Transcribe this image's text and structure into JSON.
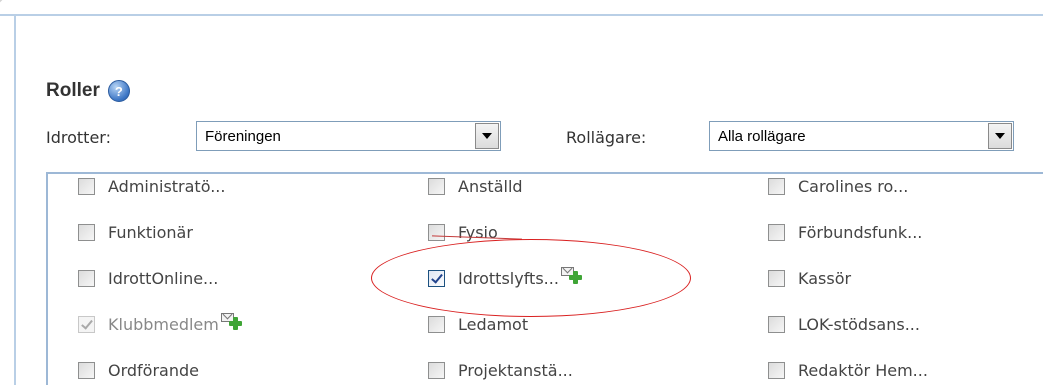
{
  "section": {
    "title": "Roller",
    "help_icon": "help-icon"
  },
  "filters": {
    "sport": {
      "label": "Idrotter:",
      "value": "Föreningen"
    },
    "owner": {
      "label": "Rollägare:",
      "value": "Alla rollägare"
    }
  },
  "roles": [
    {
      "label": "Administratö...",
      "checked": false,
      "disabled": false,
      "mail_add": false
    },
    {
      "label": "Anställd",
      "checked": false,
      "disabled": false,
      "mail_add": false
    },
    {
      "label": "Carolines ro...",
      "checked": false,
      "disabled": false,
      "mail_add": false
    },
    {
      "label": "Funktionär",
      "checked": false,
      "disabled": false,
      "mail_add": false
    },
    {
      "label": "Fysio",
      "checked": false,
      "disabled": false,
      "mail_add": false
    },
    {
      "label": "Förbundsfunk...",
      "checked": false,
      "disabled": false,
      "mail_add": false
    },
    {
      "label": "IdrottOnline...",
      "checked": false,
      "disabled": false,
      "mail_add": false
    },
    {
      "label": "Idrottslyfts...",
      "checked": true,
      "disabled": false,
      "mail_add": true
    },
    {
      "label": "Kassör",
      "checked": false,
      "disabled": false,
      "mail_add": false
    },
    {
      "label": "Klubbmedlem",
      "checked": true,
      "disabled": true,
      "mail_add": true
    },
    {
      "label": "Ledamot",
      "checked": false,
      "disabled": false,
      "mail_add": false
    },
    {
      "label": "LOK-stödsans...",
      "checked": false,
      "disabled": false,
      "mail_add": false
    },
    {
      "label": "Ordförande",
      "checked": false,
      "disabled": false,
      "mail_add": false
    },
    {
      "label": "Projektanstä...",
      "checked": false,
      "disabled": false,
      "mail_add": false
    },
    {
      "label": "Redaktör Hem...",
      "checked": false,
      "disabled": false,
      "mail_add": false
    }
  ],
  "annotation": {
    "color": "#d92020"
  }
}
